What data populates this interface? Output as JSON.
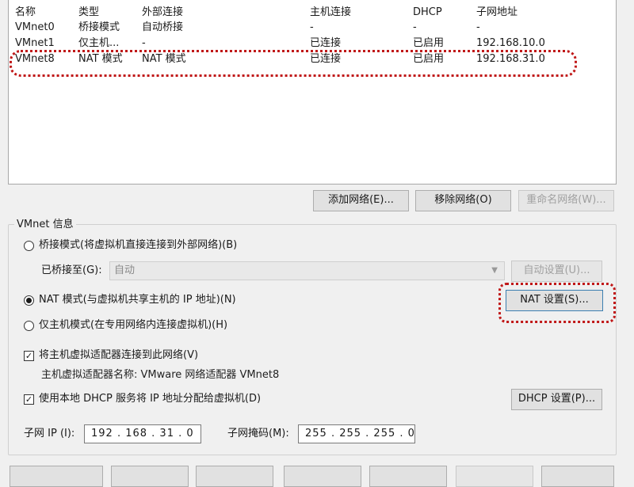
{
  "table": {
    "headers": [
      "名称",
      "类型",
      "外部连接",
      "主机连接",
      "DHCP",
      "子网地址"
    ],
    "rows": [
      [
        "VMnet0",
        "桥接模式",
        "自动桥接",
        "-",
        "-",
        "-"
      ],
      [
        "VMnet1",
        "仅主机...",
        "-",
        "已连接",
        "已启用",
        "192.168.10.0"
      ],
      [
        "VMnet8",
        "NAT 模式",
        "NAT 模式",
        "已连接",
        "已启用",
        "192.168.31.0"
      ]
    ]
  },
  "buttons": {
    "add_network": "添加网络(E)...",
    "remove_network": "移除网络(O)",
    "rename_network": "重命名网络(W)..."
  },
  "vmnet_info": {
    "title": "VMnet 信息",
    "bridged_mode": "桥接模式(将虚拟机直接连接到外部网络)(B)",
    "bridged_to_label": "已桥接至(G):",
    "bridged_to_value": "自动",
    "auto_settings": "自动设置(U)...",
    "nat_mode": "NAT 模式(与虚拟机共享主机的 IP 地址)(N)",
    "nat_settings": "NAT 设置(S)...",
    "host_only_mode": "仅主机模式(在专用网络内连接虚拟机)(H)",
    "connect_adapter": "将主机虚拟适配器连接到此网络(V)",
    "adapter_name": "主机虚拟适配器名称: VMware 网络适配器 VMnet8",
    "use_dhcp": "使用本地 DHCP 服务将 IP 地址分配给虚拟机(D)",
    "dhcp_settings": "DHCP 设置(P)...",
    "subnet_ip_label": "子网 IP (I):",
    "subnet_ip_value": "192 . 168 . 31 . 0",
    "subnet_mask_label": "子网掩码(M):",
    "subnet_mask_value": "255 . 255 . 255 . 0"
  },
  "selected_mode": "nat",
  "colors": {
    "highlight": "#c01818"
  }
}
